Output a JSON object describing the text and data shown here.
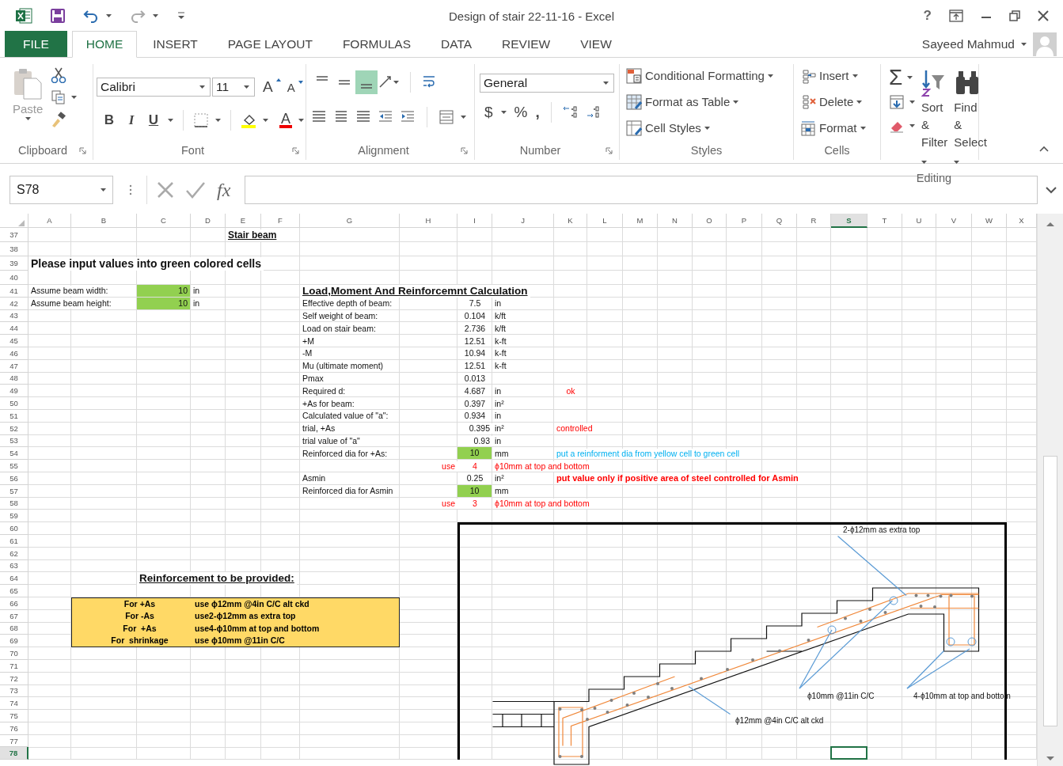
{
  "window": {
    "title": "Design of stair 22-11-16 - Excel",
    "help": "?"
  },
  "tabs": [
    {
      "label": "FILE",
      "kind": "file",
      "selected": false
    },
    {
      "label": "HOME",
      "kind": "tab",
      "selected": true
    },
    {
      "label": "INSERT",
      "kind": "tab",
      "selected": false
    },
    {
      "label": "PAGE LAYOUT",
      "kind": "tab",
      "selected": false
    },
    {
      "label": "FORMULAS",
      "kind": "tab",
      "selected": false
    },
    {
      "label": "DATA",
      "kind": "tab",
      "selected": false
    },
    {
      "label": "REVIEW",
      "kind": "tab",
      "selected": false
    },
    {
      "label": "VIEW",
      "kind": "tab",
      "selected": false
    }
  ],
  "user": {
    "name": "Sayeed Mahmud"
  },
  "ribbon": {
    "clipboard": {
      "label": "Clipboard",
      "paste": "Paste"
    },
    "font": {
      "label": "Font",
      "name": "Calibri",
      "size": "11",
      "grow": "A",
      "shrink": "A",
      "bold": "B",
      "italic": "I",
      "underline": "U",
      "color_letter": "A"
    },
    "alignment": {
      "label": "Alignment",
      "vertical": [
        {
          "selected": false
        },
        {
          "selected": false
        },
        {
          "selected": true
        }
      ]
    },
    "number": {
      "label": "Number",
      "format": "General",
      "currency": "$",
      "percent": "%",
      "comma": ","
    },
    "styles": {
      "label": "Styles",
      "buttons": [
        "Conditional Formatting",
        "Format as Table",
        "Cell Styles"
      ]
    },
    "cells": {
      "label": "Cells",
      "buttons": [
        "Insert",
        "Delete",
        "Format"
      ]
    },
    "editing": {
      "label": "Editing",
      "autosum": "Σ",
      "buttons": [
        "Sort & Filter",
        "Find & Select"
      ]
    }
  },
  "formula_bar": {
    "name_box": "S78",
    "function": "fx"
  },
  "sheet": {
    "columns": [
      {
        "label": "A",
        "selected": false
      },
      {
        "label": "B",
        "selected": false
      },
      {
        "label": "C",
        "selected": false
      },
      {
        "label": "D",
        "selected": false
      },
      {
        "label": "E",
        "selected": false
      },
      {
        "label": "F",
        "selected": false
      },
      {
        "label": "G",
        "selected": false
      },
      {
        "label": "H",
        "selected": false
      },
      {
        "label": "I",
        "selected": false
      },
      {
        "label": "J",
        "selected": false
      },
      {
        "label": "K",
        "selected": false
      },
      {
        "label": "L",
        "selected": false
      },
      {
        "label": "M",
        "selected": false
      },
      {
        "label": "N",
        "selected": false
      },
      {
        "label": "O",
        "selected": false
      },
      {
        "label": "P",
        "selected": false
      },
      {
        "label": "Q",
        "selected": false
      },
      {
        "label": "R",
        "selected": false
      },
      {
        "label": "S",
        "selected": true
      },
      {
        "label": "T",
        "selected": false
      },
      {
        "label": "U",
        "selected": false
      },
      {
        "label": "V",
        "selected": false
      },
      {
        "label": "W",
        "selected": false
      },
      {
        "label": "X",
        "selected": false
      }
    ],
    "rows": [
      {
        "number": "37",
        "selected": false,
        "cells": {
          "E": {
            "text": "Stair beam",
            "kind": "caption"
          }
        }
      },
      {
        "number": "38",
        "selected": false
      },
      {
        "number": "39",
        "selected": false,
        "cells": {
          "A": {
            "text": "Please input values into green colored cells",
            "kind": "heading"
          }
        }
      },
      {
        "number": "40",
        "selected": false
      },
      {
        "number": "41",
        "selected": false,
        "cells": {
          "A": {
            "text": "Assume beam width:",
            "kind": "label"
          },
          "C": {
            "text": "10",
            "kind": "input"
          },
          "D": {
            "text": "in",
            "kind": "label"
          },
          "G": {
            "text": "Load,Moment And Reinforcemnt Calculation",
            "kind": "title"
          }
        }
      },
      {
        "number": "42",
        "selected": false,
        "cells": {
          "A": {
            "text": "Assume beam height:",
            "kind": "label"
          },
          "C": {
            "text": "10",
            "kind": "input"
          },
          "D": {
            "text": "in",
            "kind": "label"
          },
          "G": {
            "text": "Effective depth of beam:",
            "kind": "label"
          },
          "I": {
            "text": "7.5",
            "kind": "center"
          },
          "J": {
            "text": "in",
            "kind": "label"
          }
        }
      },
      {
        "number": "43",
        "selected": false,
        "cells": {
          "G": {
            "text": "Self weight of beam:",
            "kind": "label"
          },
          "I": {
            "text": "0.104",
            "kind": "center"
          },
          "J": {
            "text": "k/ft",
            "kind": "label"
          }
        }
      },
      {
        "number": "44",
        "selected": false,
        "cells": {
          "G": {
            "text": "Load on stair beam:",
            "kind": "label"
          },
          "I": {
            "text": "2.736",
            "kind": "center"
          },
          "J": {
            "text": "k/ft",
            "kind": "label"
          }
        }
      },
      {
        "number": "45",
        "selected": false,
        "cells": {
          "G": {
            "text": "+M",
            "kind": "label"
          },
          "I": {
            "text": "12.51",
            "kind": "center"
          },
          "J": {
            "text": "k-ft",
            "kind": "label"
          }
        }
      },
      {
        "number": "46",
        "selected": false,
        "cells": {
          "G": {
            "text": "-M",
            "kind": "label"
          },
          "I": {
            "text": "10.94",
            "kind": "center"
          },
          "J": {
            "text": "k-ft",
            "kind": "label"
          }
        }
      },
      {
        "number": "47",
        "selected": false,
        "cells": {
          "G": {
            "text": "Mu (ultimate moment)",
            "kind": "label"
          },
          "I": {
            "text": "12.51",
            "kind": "center"
          },
          "J": {
            "text": "k-ft",
            "kind": "label"
          }
        }
      },
      {
        "number": "48",
        "selected": false,
        "cells": {
          "G": {
            "text": "Pmax",
            "kind": "label"
          },
          "I": {
            "text": "0.013",
            "kind": "center"
          }
        }
      },
      {
        "number": "49",
        "selected": false,
        "cells": {
          "G": {
            "text": "Required d:",
            "kind": "label"
          },
          "I": {
            "text": "4.687",
            "kind": "center"
          },
          "J": {
            "text": "in",
            "kind": "label"
          },
          "K": {
            "text": "ok",
            "kind": "red-center"
          }
        }
      },
      {
        "number": "50",
        "selected": false,
        "cells": {
          "G": {
            "text": "+As for beam:",
            "kind": "label"
          },
          "I": {
            "text": "0.397",
            "kind": "center"
          },
          "J": {
            "text": "in²",
            "kind": "label"
          }
        }
      },
      {
        "number": "51",
        "selected": false,
        "cells": {
          "G": {
            "text": "Calculated value of \"a\":",
            "kind": "label"
          },
          "I": {
            "text": "0.934",
            "kind": "center"
          },
          "J": {
            "text": "in",
            "kind": "label"
          }
        }
      },
      {
        "number": "52",
        "selected": false,
        "cells": {
          "G": {
            "text": "trial, +As",
            "kind": "label"
          },
          "I": {
            "text": "0.395",
            "kind": "number"
          },
          "J": {
            "text": "in²",
            "kind": "label"
          },
          "K": {
            "text": "controlled",
            "kind": "red"
          }
        }
      },
      {
        "number": "53",
        "selected": false,
        "cells": {
          "G": {
            "text": "trial value of \"a\"",
            "kind": "label"
          },
          "I": {
            "text": "0.93",
            "kind": "number"
          },
          "J": {
            "text": "in",
            "kind": "label"
          }
        }
      },
      {
        "number": "54",
        "selected": false,
        "cells": {
          "G": {
            "text": "Reinforced dia for +As:",
            "kind": "label"
          },
          "I": {
            "text": "10",
            "kind": "pick"
          },
          "J": {
            "text": "mm",
            "kind": "label"
          },
          "K": {
            "text": "put a reinforment dia from yellow cell to green cell",
            "kind": "note"
          }
        }
      },
      {
        "number": "55",
        "selected": false,
        "cells": {
          "H": {
            "text": "use",
            "kind": "red-right"
          },
          "I": {
            "text": "4",
            "kind": "red-center"
          },
          "J": {
            "text": "ϕ10mm at top and bottom",
            "kind": "red"
          }
        }
      },
      {
        "number": "56",
        "selected": false,
        "cells": {
          "G": {
            "text": "Asmin",
            "kind": "label"
          },
          "I": {
            "text": "0.25",
            "kind": "center"
          },
          "J": {
            "text": "in²",
            "kind": "label"
          },
          "K": {
            "text": "put value only if positive area of steel controlled for Asmin",
            "kind": "warning"
          }
        }
      },
      {
        "number": "57",
        "selected": false,
        "cells": {
          "G": {
            "text": "Reinforced dia for Asmin",
            "kind": "label"
          },
          "I": {
            "text": "10",
            "kind": "pick"
          },
          "J": {
            "text": "mm",
            "kind": "label"
          }
        }
      },
      {
        "number": "58",
        "selected": false,
        "cells": {
          "H": {
            "text": "use",
            "kind": "red-right"
          },
          "I": {
            "text": "3",
            "kind": "red-center"
          },
          "J": {
            "text": "ϕ10mm at top and bottom",
            "kind": "red"
          }
        }
      },
      {
        "number": "59",
        "selected": false
      },
      {
        "number": "60",
        "selected": false
      },
      {
        "number": "61",
        "selected": false
      },
      {
        "number": "62",
        "selected": false
      },
      {
        "number": "63",
        "selected": false
      },
      {
        "number": "64",
        "selected": false,
        "cells": {
          "C": {
            "text": "Reinforcement to be provided:",
            "kind": "title"
          }
        }
      },
      {
        "number": "65",
        "selected": false
      },
      {
        "number": "66",
        "selected": false
      },
      {
        "number": "67",
        "selected": false
      },
      {
        "number": "68",
        "selected": false
      },
      {
        "number": "69",
        "selected": false
      },
      {
        "number": "70",
        "selected": false
      },
      {
        "number": "71",
        "selected": false
      },
      {
        "number": "72",
        "selected": false
      },
      {
        "number": "73",
        "selected": false
      },
      {
        "number": "74",
        "selected": false
      },
      {
        "number": "75",
        "selected": false
      },
      {
        "number": "76",
        "selected": false
      },
      {
        "number": "77",
        "selected": false
      },
      {
        "number": "78",
        "selected": true
      }
    ],
    "summary": {
      "rows": [
        {
          "case": "For +As",
          "spec": "use ϕ12mm @4in C/C alt ckd"
        },
        {
          "case": "For -As",
          "spec": "use2-ϕ12mm as extra top"
        },
        {
          "case": "For  +As",
          "spec": "use4-ϕ10mm at top and bottom"
        },
        {
          "case": "For  shrinkage",
          "spec": "use ϕ10mm @11in C/C"
        }
      ]
    },
    "drawing": {
      "labels": [
        "2-ϕ12mm as extra top",
        "ϕ10mm @11in C/C",
        "4-ϕ10mm at top and bottom",
        "ϕ12mm @4in C/C alt ckd"
      ]
    }
  }
}
